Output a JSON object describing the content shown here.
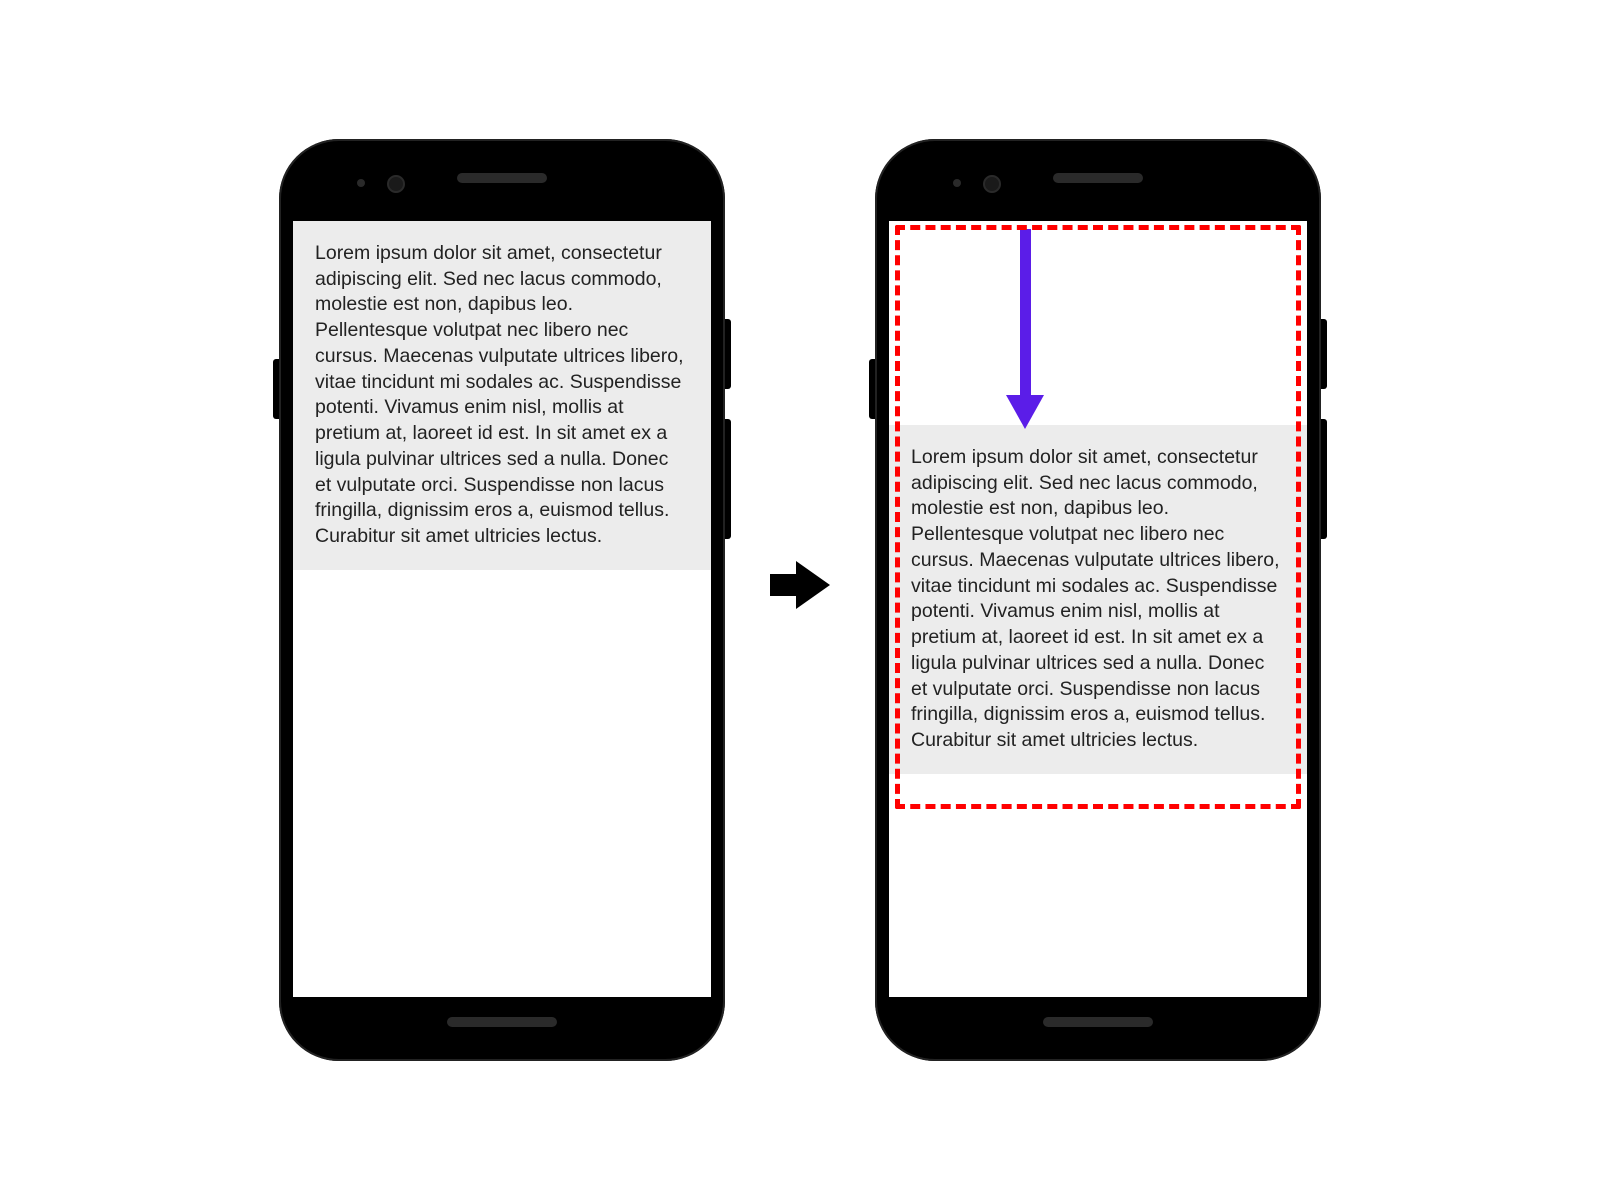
{
  "lorem_text": "Lorem ipsum dolor sit amet, consectetur adipiscing elit. Sed nec lacus commodo, molestie est non, dapibus leo. Pellentesque volutpat nec libero nec cursus. Maecenas vulputate ultrices libero, vitae tincidunt mi sodales ac. Suspendisse potenti. Vivamus enim nisl, mollis at pretium at, laoreet id est. In sit amet ex a ligula pulvinar ultrices sed a nulla. Donec et vulputate orci. Suspendisse non lacus fringilla, dignissim eros a, euismod tellus. Curabitur sit amet ultricies lectus.",
  "colors": {
    "highlight_border": "#ff0000",
    "arrow": "#5b1de8",
    "panel_bg": "#ececec"
  }
}
